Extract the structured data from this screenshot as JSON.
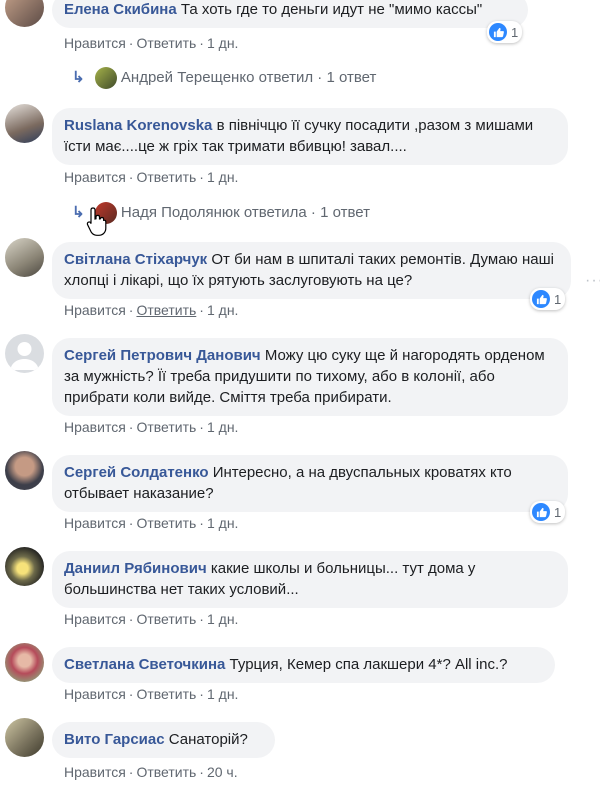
{
  "actions": {
    "like": "Нравится",
    "reply": "Ответить",
    "sep": "·"
  },
  "comments": [
    {
      "author": "Елена Скибина",
      "text": "Та хоть где то деньги идут не \"мимо кассы\"",
      "time": "1 дн.",
      "reactions": "1",
      "reply_summary": {
        "author": "Андрей Терещенко",
        "verb": "ответил",
        "count": "1 ответ"
      }
    },
    {
      "author": "Ruslana Korenovska",
      "text": "в північцю її сучку посадити ,разом з мишами їсти має....це ж гріх так тримати вбивцю! завал....",
      "time": "1 дн.",
      "reply_summary": {
        "author": "Надя Подолянюк",
        "verb": "ответила",
        "count": "1 ответ"
      }
    },
    {
      "author": "Світлана Стіхарчук",
      "text": "От би нам в шпиталі таких ремонтів. Думаю наші хлопці і лікарі, що їх рятують заслуговують на це?",
      "time": "1 дн.",
      "reactions": "1"
    },
    {
      "author": "Сергей Петрович Данович",
      "text": "Можу цю суку ще й нагородять орденом за мужність? Її треба придушити по тихому, або в колонії, або прибрати коли вийде. Сміття треба прибирати.",
      "time": "1 дн."
    },
    {
      "author": "Сергей Солдатенко",
      "text": "Интересно, а на двуспальных кроватях кто отбывает наказание?",
      "time": "1 дн.",
      "reactions": "1"
    },
    {
      "author": "Даниил Рябинович",
      "text": "какие школы и больницы... тут дома у большинства нет таких условий...",
      "time": "1 дн."
    },
    {
      "author": "Светлана Светочкина",
      "text": "Турция, Кемер спа лакшери 4*? All inc.?",
      "time": "1 дн."
    },
    {
      "author": "Вито Гарсиас",
      "text": "Санаторій?",
      "time": "20 ч."
    }
  ],
  "colors": {
    "name": "#385898",
    "bubble": "#f2f3f5",
    "meta": "#606770",
    "like": "#2d88ff"
  }
}
